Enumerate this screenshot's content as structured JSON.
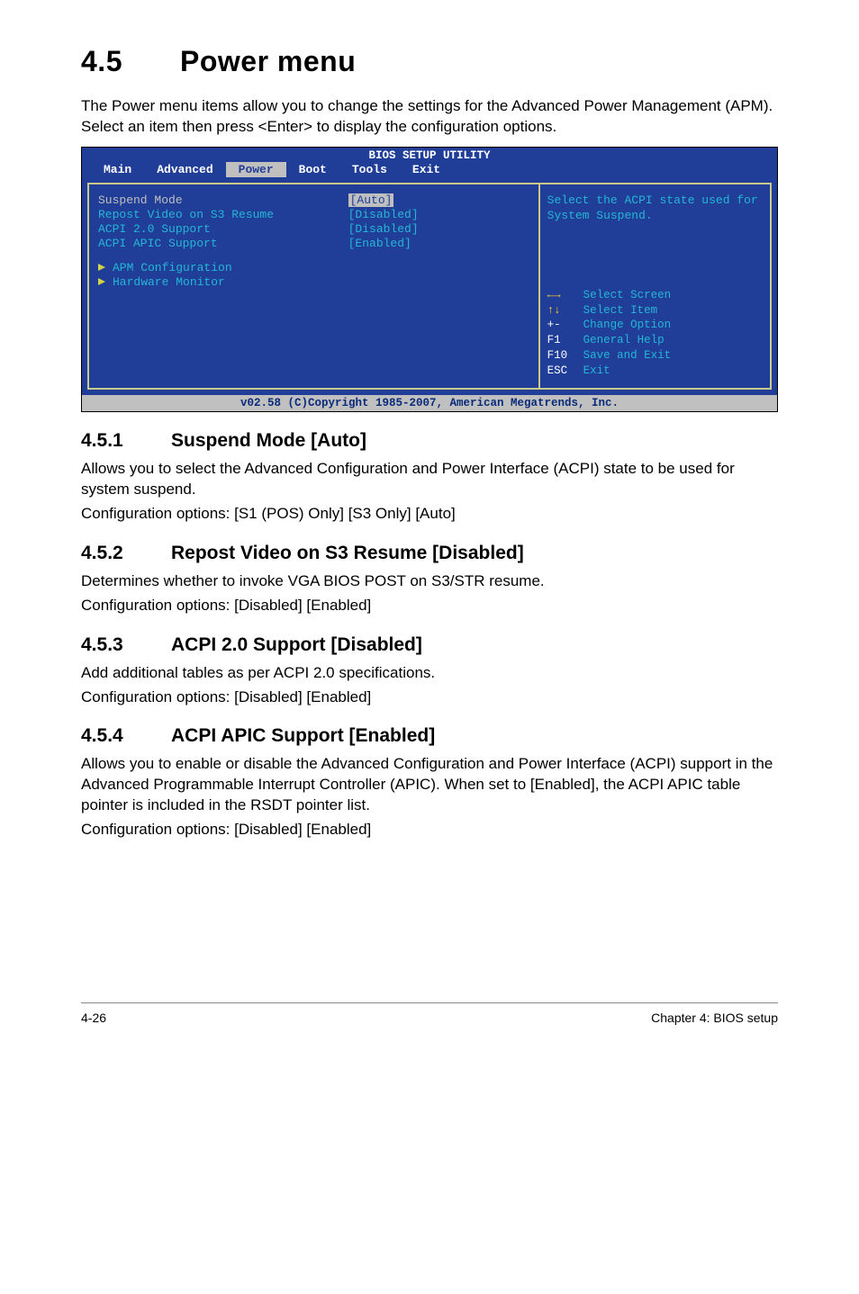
{
  "section": {
    "number": "4.5",
    "title": "Power menu",
    "intro": "The Power menu items allow you to change the settings for the Advanced Power Management (APM). Select an item then press <Enter> to display the configuration options."
  },
  "bios": {
    "title": "BIOS SETUP UTILITY",
    "tabs": [
      "Main",
      "Advanced",
      "Power",
      "Boot",
      "Tools",
      "Exit"
    ],
    "selected_tab": "Power",
    "settings": [
      {
        "label": "Suspend Mode",
        "value": "[Auto]",
        "selected": true
      },
      {
        "label": "Repost Video on S3 Resume",
        "value": "[Disabled]",
        "selected": false
      },
      {
        "label": "ACPI 2.0 Support",
        "value": "[Disabled]",
        "selected": false
      },
      {
        "label": "ACPI APIC Support",
        "value": "[Enabled]",
        "selected": false
      }
    ],
    "submenus": [
      "APM Configuration",
      "Hardware Monitor"
    ],
    "help_text": "Select the ACPI state used for System Suspend.",
    "keys": [
      {
        "k": "←→",
        "d": "Select Screen",
        "arrow": true
      },
      {
        "k": "↑↓",
        "d": "Select Item",
        "arrow": true
      },
      {
        "k": "+-",
        "d": "Change Option"
      },
      {
        "k": "F1",
        "d": "General Help"
      },
      {
        "k": "F10",
        "d": "Save and Exit"
      },
      {
        "k": "ESC",
        "d": "Exit"
      }
    ],
    "footer": "v02.58 (C)Copyright 1985-2007, American Megatrends, Inc."
  },
  "subsections": [
    {
      "number": "4.5.1",
      "title": "Suspend Mode [Auto]",
      "paragraphs": [
        "Allows you to select the Advanced Configuration and Power Interface (ACPI) state to be used for system suspend.",
        "Configuration options: [S1 (POS) Only] [S3 Only] [Auto]"
      ]
    },
    {
      "number": "4.5.2",
      "title": "Repost Video on S3 Resume [Disabled]",
      "paragraphs": [
        "Determines whether to invoke VGA BIOS POST on S3/STR resume.",
        "Configuration options: [Disabled] [Enabled]"
      ]
    },
    {
      "number": "4.5.3",
      "title": "ACPI 2.0 Support [Disabled]",
      "paragraphs": [
        "Add additional tables as per ACPI 2.0 specifications.",
        "Configuration options: [Disabled] [Enabled]"
      ]
    },
    {
      "number": "4.5.4",
      "title": "ACPI APIC Support [Enabled]",
      "paragraphs": [
        "Allows you to enable or disable the Advanced Configuration and Power Interface (ACPI) support in the Advanced Programmable Interrupt Controller (APIC). When set to [Enabled], the ACPI APIC table pointer is included in the RSDT pointer list.",
        "Configuration options: [Disabled] [Enabled]"
      ]
    }
  ],
  "footer": {
    "left": "4-26",
    "right": "Chapter 4: BIOS setup"
  }
}
